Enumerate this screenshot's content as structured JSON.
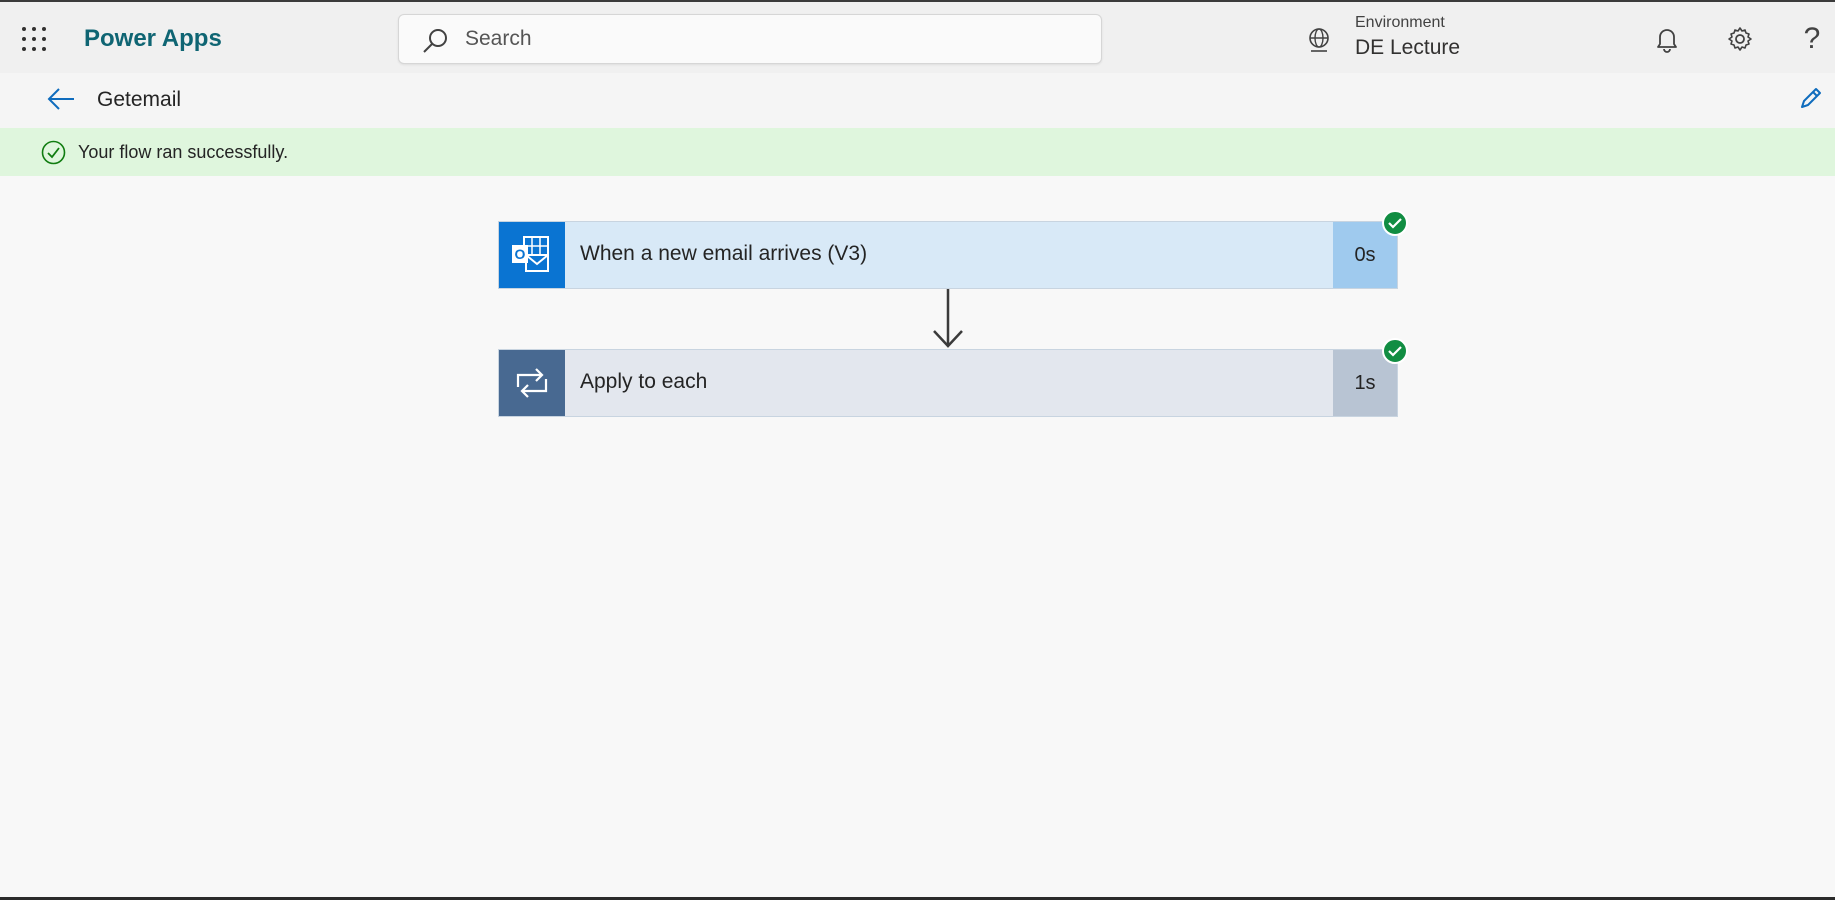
{
  "app": {
    "name": "Power Apps"
  },
  "search": {
    "placeholder": "Search"
  },
  "environment": {
    "label": "Environment",
    "value": "DE Lecture"
  },
  "flow": {
    "name": "Getemail"
  },
  "banner": {
    "message": "Your flow ran successfully.",
    "color": "#dff6dd"
  },
  "steps": [
    {
      "title": "When a new email arrives (V3)",
      "duration": "0s",
      "icon": "outlook-icon",
      "status": "succeeded"
    },
    {
      "title": "Apply to each",
      "duration": "1s",
      "icon": "loop-icon",
      "status": "succeeded"
    }
  ],
  "colors": {
    "brand": "#0f6573",
    "accent": "#0a74d2",
    "success": "#118d42"
  }
}
